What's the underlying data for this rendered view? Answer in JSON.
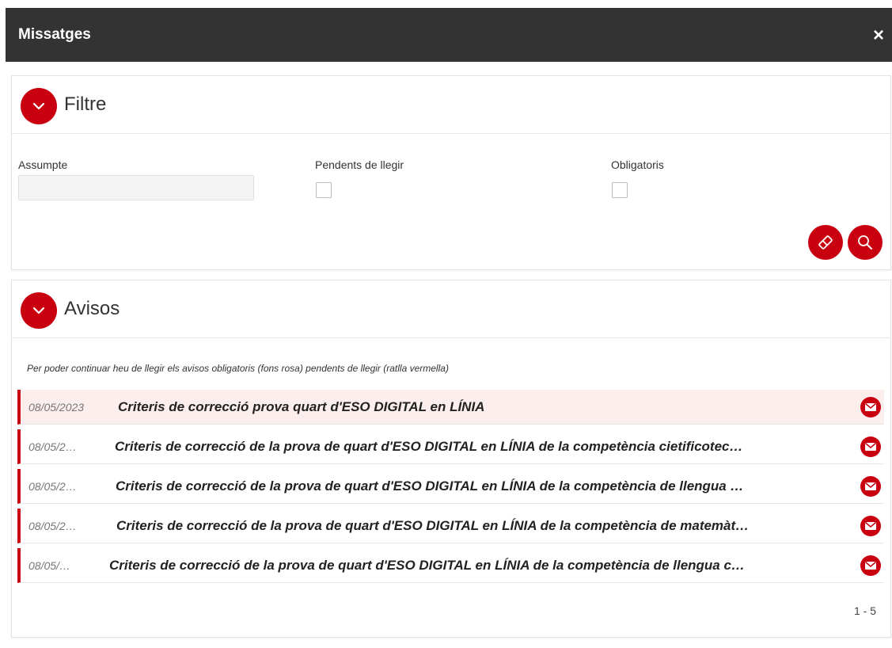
{
  "dialog": {
    "title": "Missatges",
    "close_glyph": "×"
  },
  "filter": {
    "title": "Filtre",
    "subject_label": "Assumpte",
    "subject_value": "",
    "unread_label": "Pendents de llegir",
    "unread_checked": false,
    "mandatory_label": "Obligatoris",
    "mandatory_checked": false,
    "clear_icon": "eraser-icon",
    "search_icon": "search-icon"
  },
  "notices": {
    "title": "Avisos",
    "note": "Per poder continuar heu de llegir els avisos obligatoris (fons rosa) pendents de llegir (ratlla vermella)",
    "rows": [
      {
        "date": "08/05/2023",
        "subject": "Criteris de correcció prova quart d'ESO DIGITAL en LÍNIA",
        "mandatory": true,
        "unread": true
      },
      {
        "date": "08/05/2…",
        "subject": "Criteris de correcció de la prova de quart d'ESO DIGITAL en LÍNIA de la competència cietificotec…",
        "mandatory": false,
        "unread": true
      },
      {
        "date": "08/05/2…",
        "subject": "Criteris de correcció de la prova de quart d'ESO DIGITAL en LÍNIA de la competència de llengua …",
        "mandatory": false,
        "unread": true
      },
      {
        "date": "08/05/2…",
        "subject": "Criteris de correcció de la prova de quart d'ESO DIGITAL en LÍNIA de la competència de matemàt…",
        "mandatory": false,
        "unread": true
      },
      {
        "date": "08/05/…",
        "subject": "Criteris de correcció de la prova de quart d'ESO DIGITAL en LÍNIA de la competència de llengua c…",
        "mandatory": false,
        "unread": true
      }
    ],
    "pager": "1 - 5",
    "mail_icon": "envelope-icon"
  },
  "colors": {
    "accent": "#c8000f",
    "titlebar": "#333333",
    "mandatory_bg": "#fdeeee"
  }
}
